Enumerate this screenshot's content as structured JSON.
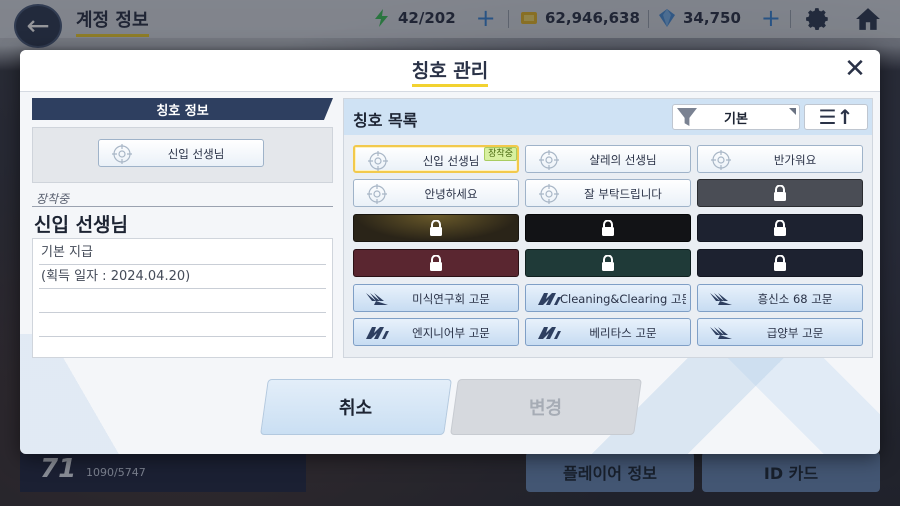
{
  "topbar": {
    "title": "계정 정보",
    "ap": "42/202",
    "credits": "62,946,638",
    "gems": "34,750"
  },
  "background": {
    "level": "71",
    "exp": "1090/5747",
    "player_info_button": "플레이어 정보",
    "id_card_button": "ID 카드"
  },
  "modal": {
    "title": "칭호 관리",
    "info_header": "칭호 정보",
    "current_title": "신입 선생님",
    "equipped_label": "장착중",
    "equipped_name": "신입 선생님",
    "description_lines": [
      "기본 지급",
      "(획득 일자 : 2024.04.20)",
      "",
      "",
      ""
    ],
    "list_title": "칭호 목록",
    "filter_label": "기본",
    "cancel_label": "취소",
    "change_label": "변경",
    "equipped_badge": "장착중"
  },
  "titles": [
    {
      "label": "신입 선생님",
      "style": "normal",
      "selected": true
    },
    {
      "label": "샬레의 선생님",
      "style": "normal"
    },
    {
      "label": "반가워요",
      "style": "normal"
    },
    {
      "label": "안녕하세요",
      "style": "normal"
    },
    {
      "label": "잘 부탁드립니다",
      "style": "normal"
    },
    {
      "label": "",
      "style": "locked-gray"
    },
    {
      "label": "",
      "style": "locked-gold"
    },
    {
      "label": "",
      "style": "locked-black"
    },
    {
      "label": "",
      "style": "locked-navy"
    },
    {
      "label": "",
      "style": "locked-wine"
    },
    {
      "label": "",
      "style": "locked-teal"
    },
    {
      "label": "",
      "style": "locked-navy"
    },
    {
      "label": "미식연구회 고문",
      "style": "club",
      "logo": "gourmet"
    },
    {
      "label": "Cleaning&Clearing 고문",
      "style": "club",
      "logo": "millennium"
    },
    {
      "label": "흥신소 68 고문",
      "style": "club",
      "logo": "gourmet"
    },
    {
      "label": "엔지니어부 고문",
      "style": "club",
      "logo": "millennium"
    },
    {
      "label": "베리타스 고문",
      "style": "club",
      "logo": "millennium"
    },
    {
      "label": "급양부 고문",
      "style": "club",
      "logo": "gourmet"
    }
  ],
  "colors": {
    "accent_yellow": "#f2d230",
    "navy": "#2e3f60",
    "plus_blue": "#3a86d8"
  }
}
